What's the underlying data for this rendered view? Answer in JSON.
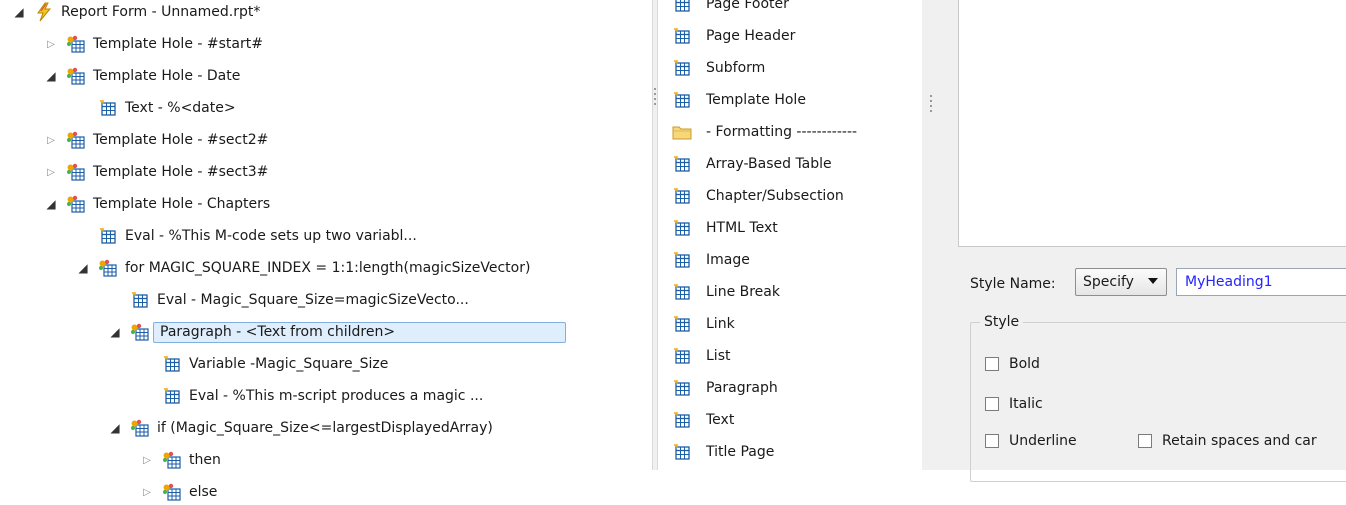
{
  "tree": {
    "items": [
      {
        "label": "Report Form - Unnamed.rpt*",
        "toggle": "open",
        "icon": "report-bolt-icon"
      },
      {
        "label": "Template Hole - #start#",
        "toggle": "closed",
        "icon": "template-hole-icon"
      },
      {
        "label": "Template Hole - Date",
        "toggle": "open",
        "icon": "template-hole-icon"
      },
      {
        "label": "Text - %<date>",
        "toggle": "none",
        "icon": "component-icon"
      },
      {
        "label": "Template Hole - #sect2#",
        "toggle": "closed",
        "icon": "template-hole-icon"
      },
      {
        "label": "Template Hole - #sect3#",
        "toggle": "closed",
        "icon": "template-hole-icon"
      },
      {
        "label": "Template Hole - Chapters",
        "toggle": "open",
        "icon": "template-hole-icon"
      },
      {
        "label": "Eval - %This M-code sets up two variabl...",
        "toggle": "none",
        "icon": "component-icon"
      },
      {
        "label": "for MAGIC_SQUARE_INDEX = 1:1:length(magicSizeVector)",
        "toggle": "open",
        "icon": "template-hole-icon"
      },
      {
        "label": "Eval - Magic_Square_Size=magicSizeVecto...",
        "toggle": "none",
        "icon": "component-icon"
      },
      {
        "label": "Paragraph - <Text from children>",
        "toggle": "open",
        "icon": "template-hole-icon",
        "selected": true
      },
      {
        "label": "Variable -Magic_Square_Size",
        "toggle": "none",
        "icon": "component-icon"
      },
      {
        "label": "Eval - %This m-script produces a magic ...",
        "toggle": "none",
        "icon": "component-icon"
      },
      {
        "label": "if (Magic_Square_Size<=largestDisplayedArray)",
        "toggle": "open",
        "icon": "template-hole-icon"
      },
      {
        "label": "then",
        "toggle": "closed",
        "icon": "template-hole-icon"
      },
      {
        "label": "else",
        "toggle": "closed",
        "icon": "template-hole-icon"
      }
    ]
  },
  "palette": {
    "items": [
      {
        "label": "Page Footer",
        "icon": "component-icon"
      },
      {
        "label": "Page Header",
        "icon": "component-icon"
      },
      {
        "label": "Subform",
        "icon": "component-icon"
      },
      {
        "label": "Template Hole",
        "icon": "component-icon"
      },
      {
        "label": "- Formatting ------------",
        "icon": "folder-icon"
      },
      {
        "label": "Array-Based Table",
        "icon": "component-icon"
      },
      {
        "label": "Chapter/Subsection",
        "icon": "component-icon"
      },
      {
        "label": "HTML Text",
        "icon": "component-icon"
      },
      {
        "label": "Image",
        "icon": "component-icon"
      },
      {
        "label": "Line Break",
        "icon": "component-icon"
      },
      {
        "label": "Link",
        "icon": "component-icon"
      },
      {
        "label": "List",
        "icon": "component-icon"
      },
      {
        "label": "Paragraph",
        "icon": "component-icon"
      },
      {
        "label": "Text",
        "icon": "component-icon"
      },
      {
        "label": "Title Page",
        "icon": "component-icon"
      }
    ]
  },
  "props": {
    "style_name_label": "Style Name:",
    "style_select_value": "Specify",
    "style_name_value": "MyHeading1",
    "style_group_title": "Style",
    "bold_label": "Bold",
    "italic_label": "Italic",
    "underline_label": "Underline",
    "retain_label": "Retain spaces and car"
  }
}
